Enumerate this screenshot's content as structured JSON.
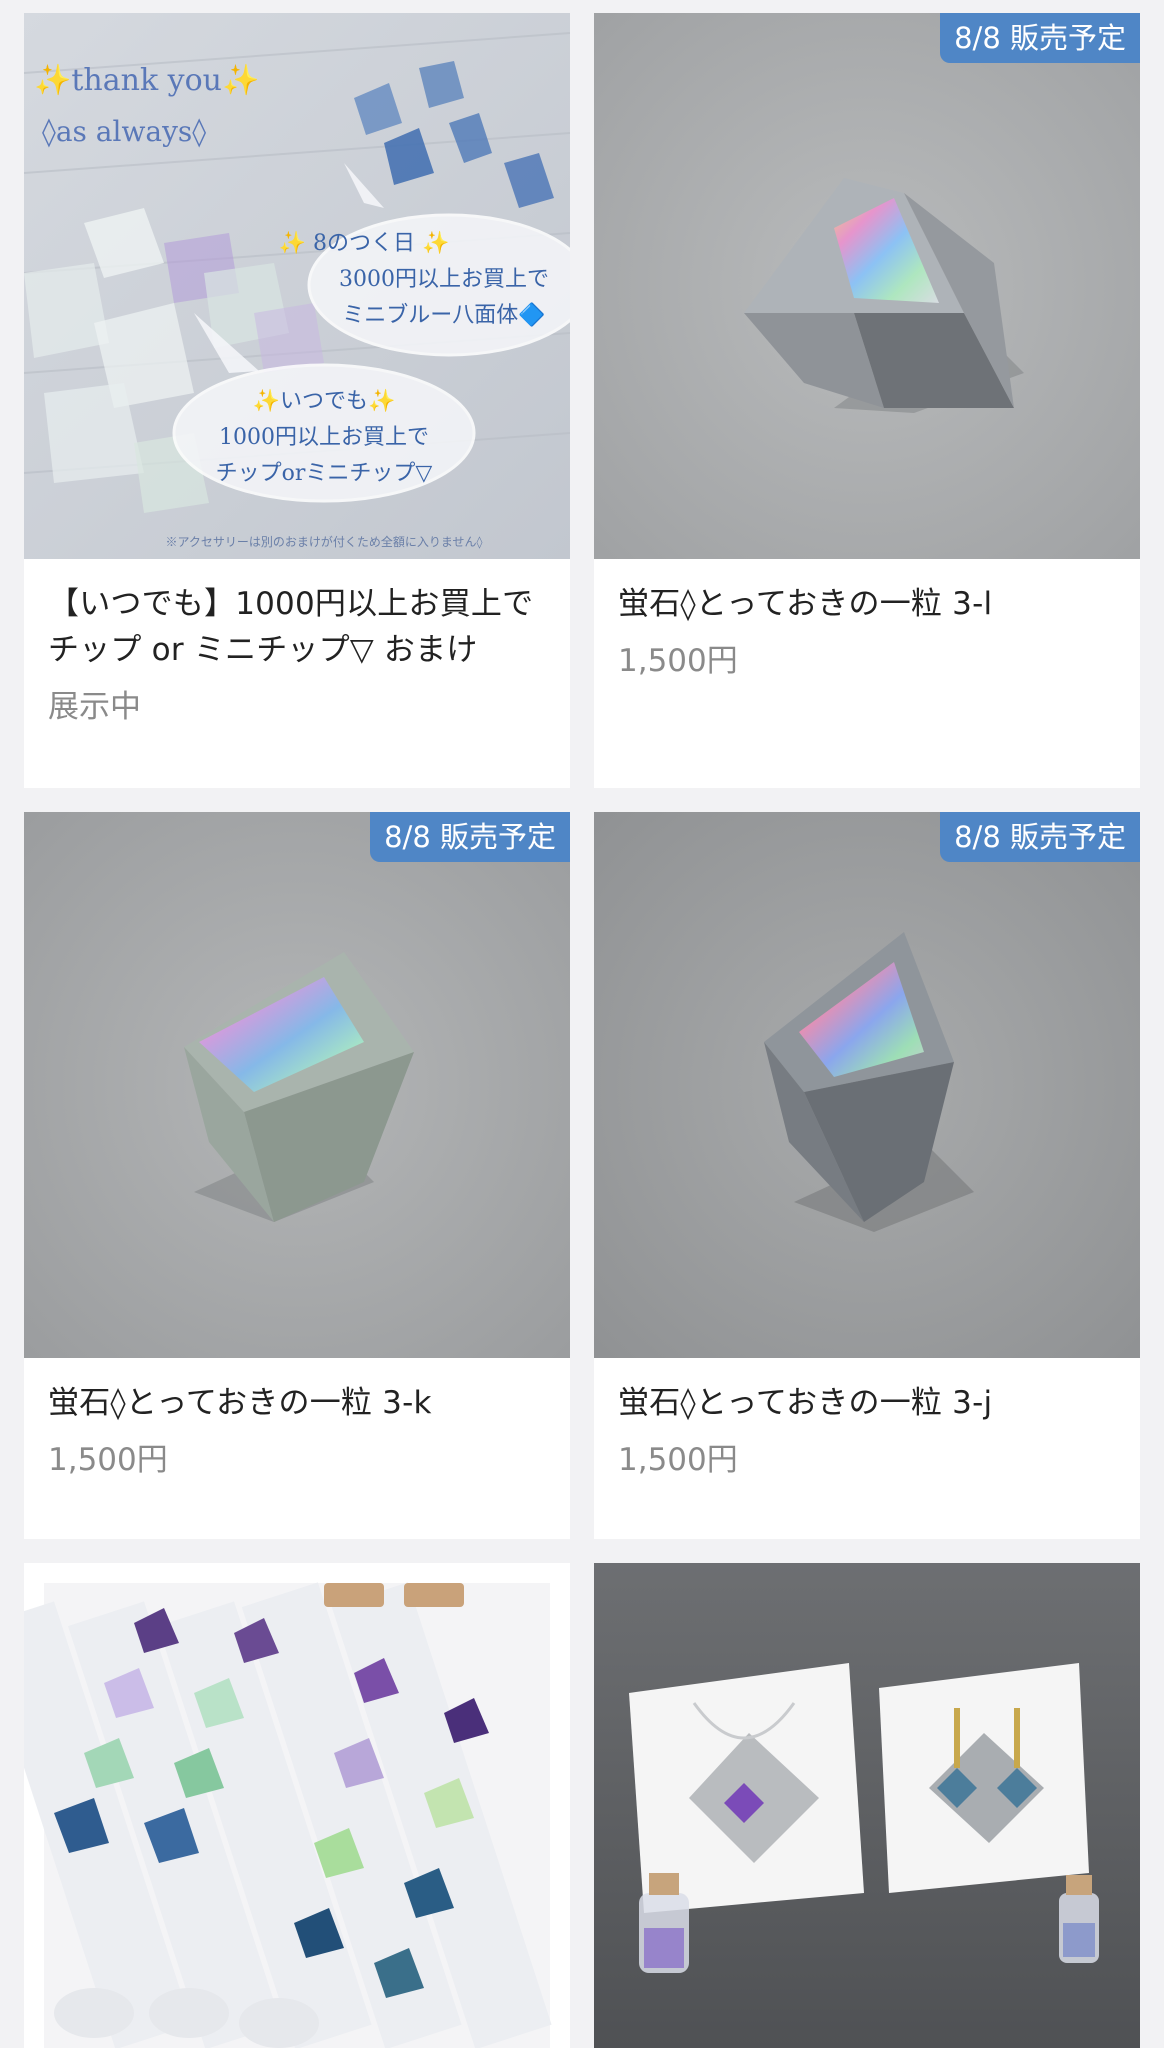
{
  "products": [
    {
      "title": "【いつでも】1000円以上お買上でチップ or ミニチップ▽ おまけ",
      "status": "展示中",
      "badge": "",
      "image_icon": "promo-graphic-fluorite-pieces",
      "overlay": {
        "line1": "✨thank you✨",
        "line2": "◊as always◊",
        "bubble1_l1": "✨ 8のつく日 ✨",
        "bubble1_l2": "3000円以上お買上で",
        "bubble1_l3": "ミニブルー八面体🔷",
        "bubble2_l1": "✨いつでも✨",
        "bubble2_l2": "1000円以上お買上で",
        "bubble2_l3": "チップorミニチップ▽",
        "note": "※アクセサリーは別のおまけが付くため全額に入りません◊"
      }
    },
    {
      "title": "蛍石◊とっておきの一粒 3-l",
      "price": "1,500円",
      "badge": "8/8 販売予定",
      "image_icon": "fluorite-octahedron-photo"
    },
    {
      "title": "蛍石◊とっておきの一粒 3-k",
      "price": "1,500円",
      "badge": "8/8 販売予定",
      "image_icon": "fluorite-octahedron-photo"
    },
    {
      "title": "蛍石◊とっておきの一粒 3-j",
      "price": "1,500円",
      "badge": "8/8 販売予定",
      "image_icon": "fluorite-octahedron-photo"
    },
    {
      "image_icon": "fluorite-vials-photo"
    },
    {
      "image_icon": "fluorite-jewelry-display-photo"
    }
  ],
  "colors": {
    "background": "#f2f2f4",
    "badge": "#4f86c6",
    "price_text": "#8a8a8a"
  }
}
